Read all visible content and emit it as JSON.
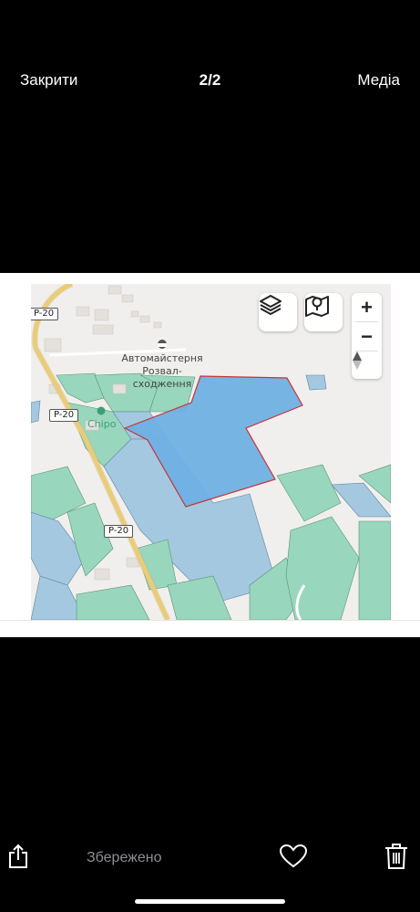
{
  "header": {
    "close_label": "Закрити",
    "counter": "2/2",
    "media_label": "Медіа"
  },
  "map": {
    "road_labels": [
      "P-20",
      "P-20",
      "P-20"
    ],
    "poi_name_line1": "Автомайстерня",
    "poi_name_line2": "Розвал-сходження",
    "shop_name": "Chipo",
    "zoom_in_label": "+",
    "zoom_out_label": "−",
    "colors": {
      "selected_parcel": "#6fb0e3",
      "selected_border": "#c8333a",
      "parcel_green": "#8fd4b8",
      "parcel_blue": "#9cc4df",
      "road": "#f5d98a",
      "background": "#f1efed"
    },
    "layer_icon": "layers-icon",
    "map_pin_icon": "map-pin-icon",
    "compass_icon": "compass-icon"
  },
  "caption_fragment": "",
  "footer": {
    "status": "Збережено",
    "share_icon": "share-icon",
    "like_icon": "heart-icon",
    "delete_icon": "trash-icon"
  }
}
